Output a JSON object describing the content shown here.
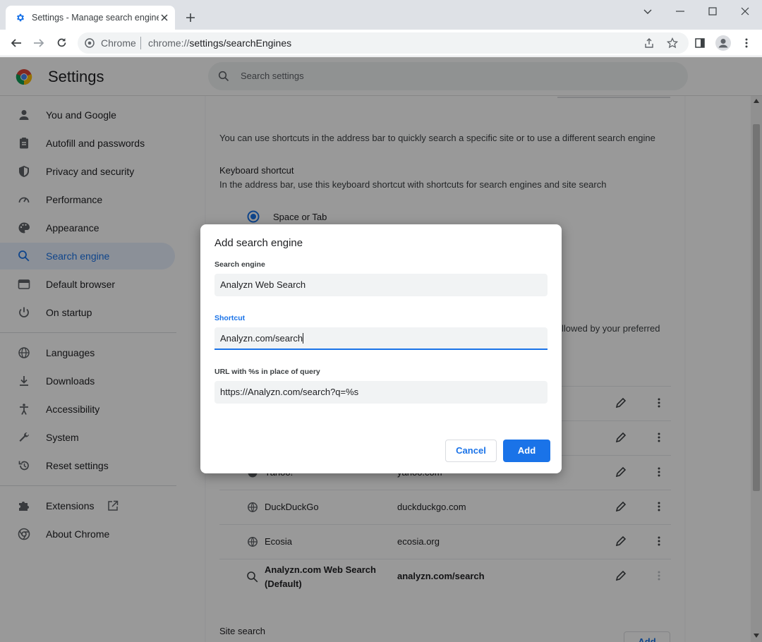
{
  "browser": {
    "tab_title": "Settings - Manage search engine",
    "omnibox_site": "Chrome",
    "omnibox_url_prefix": "chrome://",
    "omnibox_url_path": "settings/searchEngines"
  },
  "header": {
    "title": "Settings",
    "search_placeholder": "Search settings"
  },
  "sidebar": {
    "items": [
      {
        "label": "You and Google",
        "icon": "person-icon"
      },
      {
        "label": "Autofill and passwords",
        "icon": "clipboard-icon"
      },
      {
        "label": "Privacy and security",
        "icon": "shield-icon"
      },
      {
        "label": "Performance",
        "icon": "speedometer-icon"
      },
      {
        "label": "Appearance",
        "icon": "palette-icon"
      },
      {
        "label": "Search engine",
        "icon": "search-icon",
        "active": true
      },
      {
        "label": "Default browser",
        "icon": "browser-icon"
      },
      {
        "label": "On startup",
        "icon": "power-icon"
      },
      {
        "label": "Languages",
        "icon": "globe-icon"
      },
      {
        "label": "Downloads",
        "icon": "download-icon"
      },
      {
        "label": "Accessibility",
        "icon": "accessibility-icon"
      },
      {
        "label": "System",
        "icon": "wrench-icon"
      },
      {
        "label": "Reset settings",
        "icon": "reset-icon"
      },
      {
        "label": "Extensions",
        "icon": "puzzle-icon"
      },
      {
        "label": "About Chrome",
        "icon": "chrome-icon"
      }
    ]
  },
  "main": {
    "intro": "You can use shortcuts in the address bar to quickly search a specific site or to use a different search engine",
    "keyboard_heading": "Keyboard shortcut",
    "keyboard_desc": "In the address bar, use this keyboard shortcut with shortcuts for search engines and site search",
    "radio_option": "Space or Tab",
    "partial_text": "llowed by your preferred",
    "engines": [
      {
        "name": "Yahoo!",
        "keyword": "yahoo.com"
      },
      {
        "name": "DuckDuckGo",
        "keyword": "duckduckgo.com"
      },
      {
        "name": "Ecosia",
        "keyword": "ecosia.org"
      },
      {
        "name": "Analyzn.com Web Search",
        "name2": "(Default)",
        "keyword": "analyzn.com/search"
      }
    ],
    "site_search_heading": "Site search",
    "site_search_add": "Add"
  },
  "dialog": {
    "title": "Add search engine",
    "engine_label": "Search engine",
    "engine_value": "Analyzn Web Search",
    "shortcut_label": "Shortcut",
    "shortcut_value": "Analyzn.com/search",
    "url_label": "URL with %s in place of query",
    "url_value": "https://Analyzn.com/search?q=%s",
    "cancel_label": "Cancel",
    "add_label": "Add"
  },
  "colors": {
    "accent": "#1a73e8",
    "active_nav_bg": "#e8f0fe"
  }
}
